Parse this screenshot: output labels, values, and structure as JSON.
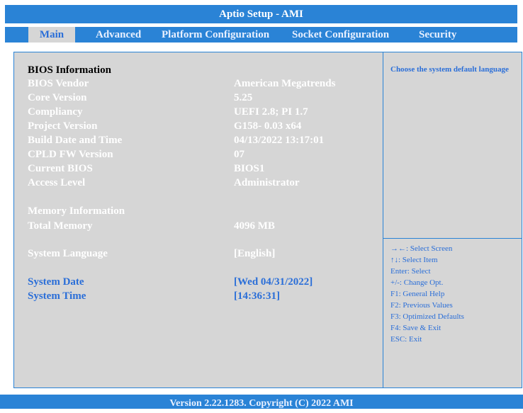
{
  "title": "Aptio Setup - AMI",
  "tabs": [
    {
      "label": "Main"
    },
    {
      "label": "Advanced"
    },
    {
      "label": "Platform Configuration"
    },
    {
      "label": "Socket Configuration"
    },
    {
      "label": "Security"
    }
  ],
  "bios_info": {
    "heading": "BIOS Information",
    "rows": [
      {
        "label": "BIOS Vendor",
        "value": "American Megatrends"
      },
      {
        "label": "Core Version",
        "value": "5.25"
      },
      {
        "label": "Compliancy",
        "value": "UEFI 2.8; PI 1.7"
      },
      {
        "label": "Project Version",
        "value": "G158- 0.03 x64"
      },
      {
        "label": "Build Date and Time",
        "value": "04/13/2022 13:17:01"
      },
      {
        "label": "CPLD FW Version",
        "value": "07"
      },
      {
        "label": "Current BIOS",
        "value": "BIOS1"
      },
      {
        "label": "Access Level",
        "value": "Administrator"
      }
    ]
  },
  "memory_info": {
    "heading": "Memory Information",
    "label": "Total Memory",
    "value": "4096 MB"
  },
  "settings": {
    "language_label": "System Language",
    "language_value": "[English]",
    "date_label": "System Date",
    "date_value": "[Wed 04/31/2022]",
    "time_label": "System Time",
    "time_value": "[14:36:31]"
  },
  "help_text": "Choose the system default language",
  "keys": [
    "→←: Select Screen",
    "↑↓: Select Item",
    "Enter: Select",
    "+/-: Change Opt.",
    "F1: General Help",
    "F2: Previous Values",
    "F3: Optimized Defaults",
    "F4: Save & Exit",
    "ESC: Exit"
  ],
  "footer": "Version 2.22.1283. Copyright (C) 2022 AMI",
  "colors": {
    "bar": "#2a83d6",
    "panel": "#d6d6d6",
    "selectable": "#2a6ed8",
    "static_label": "#ffffff"
  }
}
